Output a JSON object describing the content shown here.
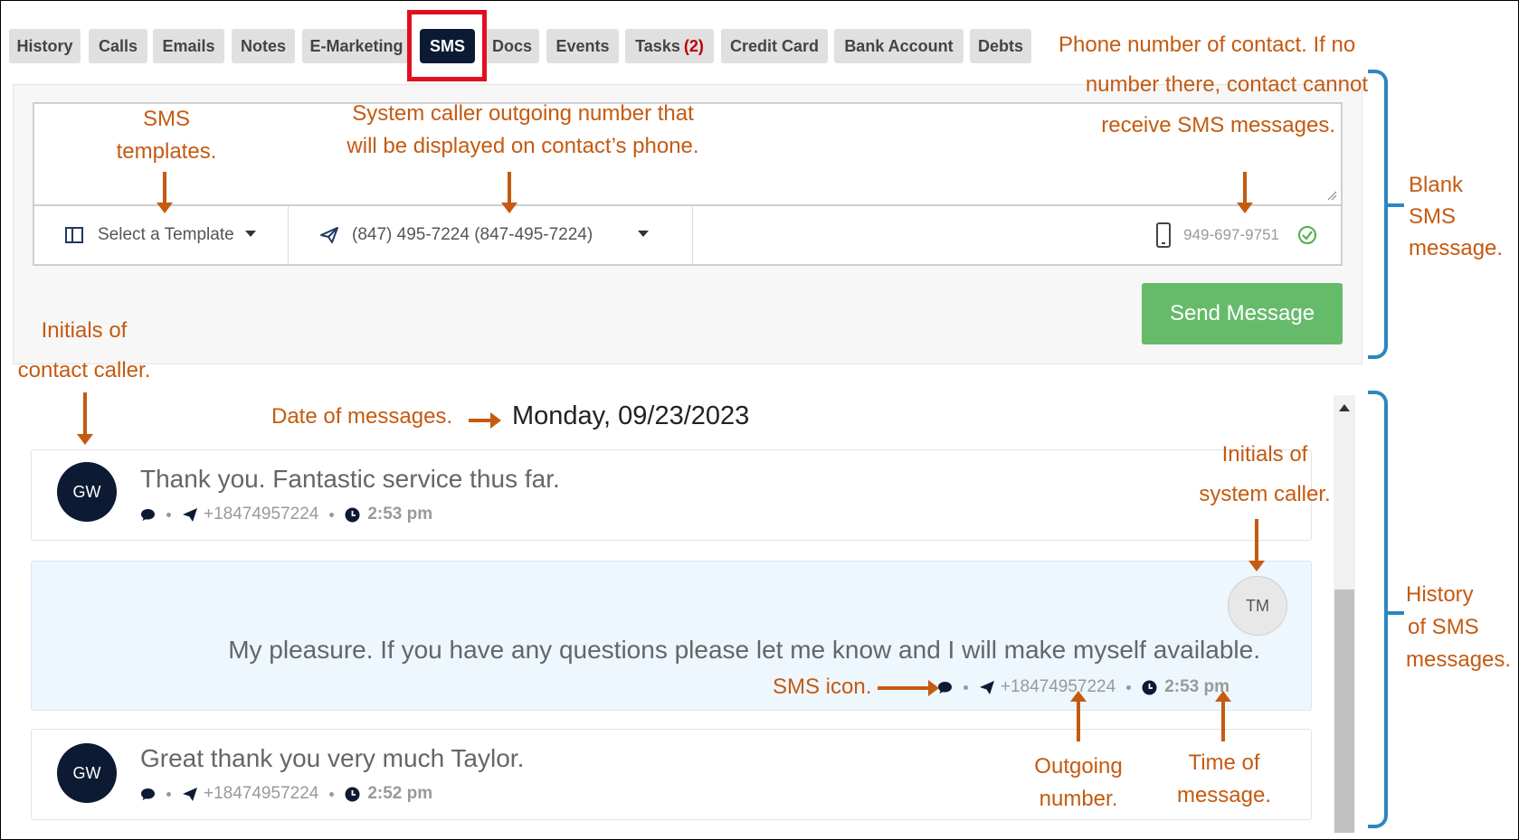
{
  "tabs": [
    {
      "label": "History"
    },
    {
      "label": "Calls"
    },
    {
      "label": "Emails"
    },
    {
      "label": "Notes"
    },
    {
      "label": "E-Marketing"
    },
    {
      "label": "SMS",
      "active": true
    },
    {
      "label": "Docs"
    },
    {
      "label": "Events"
    },
    {
      "label": "Tasks",
      "count": "(2)"
    },
    {
      "label": "Credit Card"
    },
    {
      "label": "Bank Account"
    },
    {
      "label": "Debts"
    }
  ],
  "compose": {
    "template_select": "Select a Template",
    "outgoing_number": "(847) 495-7224 (847-495-7224)",
    "contact_phone": "949-697-9751",
    "send_button": "Send Message"
  },
  "history": {
    "date": "Monday, 09/23/2023",
    "messages": [
      {
        "direction": "incoming",
        "initials": "GW",
        "text": "Thank you. Fantastic service thus far.",
        "number": "+18474957224",
        "time": "2:53 pm"
      },
      {
        "direction": "outgoing",
        "initials": "TM",
        "text": "My pleasure. If you have any questions please let me know and I will make myself available.",
        "number": "+18474957224",
        "time": "2:53 pm"
      },
      {
        "direction": "incoming",
        "initials": "GW",
        "text": "Great thank you very much Taylor.",
        "number": "+18474957224",
        "time": "2:52 pm"
      }
    ]
  },
  "annotations": {
    "sms_templates": [
      "SMS",
      "templates."
    ],
    "outgoing_number": [
      "System caller outgoing number that",
      "will be displayed on contact’s phone."
    ],
    "contact_phone": [
      "Phone number of contact. If no",
      "number there, contact cannot",
      "receive SMS messages."
    ],
    "blank_sms": [
      "Blank",
      "SMS",
      "message."
    ],
    "contact_initials": [
      "Initials of",
      "contact caller."
    ],
    "date_of_messages": "Date of messages.",
    "system_initials": [
      "Initials of",
      "system caller."
    ],
    "history_sms": [
      "History",
      "of SMS",
      "messages."
    ],
    "sms_icon": "SMS icon.",
    "outgoing_label": [
      "Outgoing",
      "number."
    ],
    "time_label": [
      "Time of",
      "message."
    ]
  },
  "colors": {
    "active_tab": "#0c1a33",
    "highlight": "#e01020",
    "send_button": "#66bb6a",
    "annotation": "#c55a11",
    "brace": "#2e86c1"
  }
}
